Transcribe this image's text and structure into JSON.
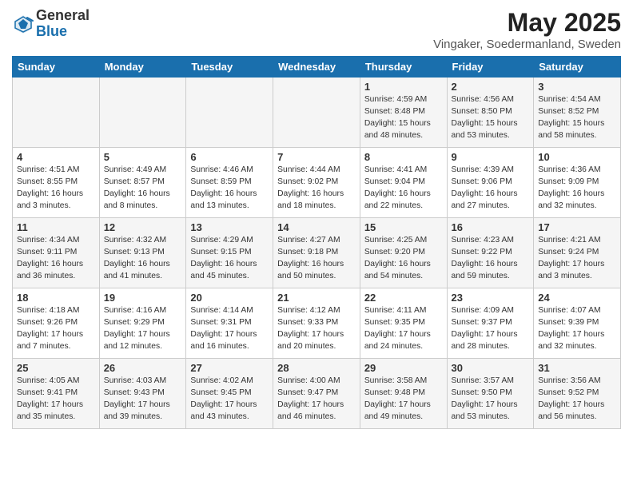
{
  "header": {
    "logo_general": "General",
    "logo_blue": "Blue",
    "month_title": "May 2025",
    "location": "Vingaker, Soedermanland, Sweden"
  },
  "weekdays": [
    "Sunday",
    "Monday",
    "Tuesday",
    "Wednesday",
    "Thursday",
    "Friday",
    "Saturday"
  ],
  "weeks": [
    [
      {
        "day": "",
        "info": ""
      },
      {
        "day": "",
        "info": ""
      },
      {
        "day": "",
        "info": ""
      },
      {
        "day": "",
        "info": ""
      },
      {
        "day": "1",
        "info": "Sunrise: 4:59 AM\nSunset: 8:48 PM\nDaylight: 15 hours\nand 48 minutes."
      },
      {
        "day": "2",
        "info": "Sunrise: 4:56 AM\nSunset: 8:50 PM\nDaylight: 15 hours\nand 53 minutes."
      },
      {
        "day": "3",
        "info": "Sunrise: 4:54 AM\nSunset: 8:52 PM\nDaylight: 15 hours\nand 58 minutes."
      }
    ],
    [
      {
        "day": "4",
        "info": "Sunrise: 4:51 AM\nSunset: 8:55 PM\nDaylight: 16 hours\nand 3 minutes."
      },
      {
        "day": "5",
        "info": "Sunrise: 4:49 AM\nSunset: 8:57 PM\nDaylight: 16 hours\nand 8 minutes."
      },
      {
        "day": "6",
        "info": "Sunrise: 4:46 AM\nSunset: 8:59 PM\nDaylight: 16 hours\nand 13 minutes."
      },
      {
        "day": "7",
        "info": "Sunrise: 4:44 AM\nSunset: 9:02 PM\nDaylight: 16 hours\nand 18 minutes."
      },
      {
        "day": "8",
        "info": "Sunrise: 4:41 AM\nSunset: 9:04 PM\nDaylight: 16 hours\nand 22 minutes."
      },
      {
        "day": "9",
        "info": "Sunrise: 4:39 AM\nSunset: 9:06 PM\nDaylight: 16 hours\nand 27 minutes."
      },
      {
        "day": "10",
        "info": "Sunrise: 4:36 AM\nSunset: 9:09 PM\nDaylight: 16 hours\nand 32 minutes."
      }
    ],
    [
      {
        "day": "11",
        "info": "Sunrise: 4:34 AM\nSunset: 9:11 PM\nDaylight: 16 hours\nand 36 minutes."
      },
      {
        "day": "12",
        "info": "Sunrise: 4:32 AM\nSunset: 9:13 PM\nDaylight: 16 hours\nand 41 minutes."
      },
      {
        "day": "13",
        "info": "Sunrise: 4:29 AM\nSunset: 9:15 PM\nDaylight: 16 hours\nand 45 minutes."
      },
      {
        "day": "14",
        "info": "Sunrise: 4:27 AM\nSunset: 9:18 PM\nDaylight: 16 hours\nand 50 minutes."
      },
      {
        "day": "15",
        "info": "Sunrise: 4:25 AM\nSunset: 9:20 PM\nDaylight: 16 hours\nand 54 minutes."
      },
      {
        "day": "16",
        "info": "Sunrise: 4:23 AM\nSunset: 9:22 PM\nDaylight: 16 hours\nand 59 minutes."
      },
      {
        "day": "17",
        "info": "Sunrise: 4:21 AM\nSunset: 9:24 PM\nDaylight: 17 hours\nand 3 minutes."
      }
    ],
    [
      {
        "day": "18",
        "info": "Sunrise: 4:18 AM\nSunset: 9:26 PM\nDaylight: 17 hours\nand 7 minutes."
      },
      {
        "day": "19",
        "info": "Sunrise: 4:16 AM\nSunset: 9:29 PM\nDaylight: 17 hours\nand 12 minutes."
      },
      {
        "day": "20",
        "info": "Sunrise: 4:14 AM\nSunset: 9:31 PM\nDaylight: 17 hours\nand 16 minutes."
      },
      {
        "day": "21",
        "info": "Sunrise: 4:12 AM\nSunset: 9:33 PM\nDaylight: 17 hours\nand 20 minutes."
      },
      {
        "day": "22",
        "info": "Sunrise: 4:11 AM\nSunset: 9:35 PM\nDaylight: 17 hours\nand 24 minutes."
      },
      {
        "day": "23",
        "info": "Sunrise: 4:09 AM\nSunset: 9:37 PM\nDaylight: 17 hours\nand 28 minutes."
      },
      {
        "day": "24",
        "info": "Sunrise: 4:07 AM\nSunset: 9:39 PM\nDaylight: 17 hours\nand 32 minutes."
      }
    ],
    [
      {
        "day": "25",
        "info": "Sunrise: 4:05 AM\nSunset: 9:41 PM\nDaylight: 17 hours\nand 35 minutes."
      },
      {
        "day": "26",
        "info": "Sunrise: 4:03 AM\nSunset: 9:43 PM\nDaylight: 17 hours\nand 39 minutes."
      },
      {
        "day": "27",
        "info": "Sunrise: 4:02 AM\nSunset: 9:45 PM\nDaylight: 17 hours\nand 43 minutes."
      },
      {
        "day": "28",
        "info": "Sunrise: 4:00 AM\nSunset: 9:47 PM\nDaylight: 17 hours\nand 46 minutes."
      },
      {
        "day": "29",
        "info": "Sunrise: 3:58 AM\nSunset: 9:48 PM\nDaylight: 17 hours\nand 49 minutes."
      },
      {
        "day": "30",
        "info": "Sunrise: 3:57 AM\nSunset: 9:50 PM\nDaylight: 17 hours\nand 53 minutes."
      },
      {
        "day": "31",
        "info": "Sunrise: 3:56 AM\nSunset: 9:52 PM\nDaylight: 17 hours\nand 56 minutes."
      }
    ]
  ]
}
